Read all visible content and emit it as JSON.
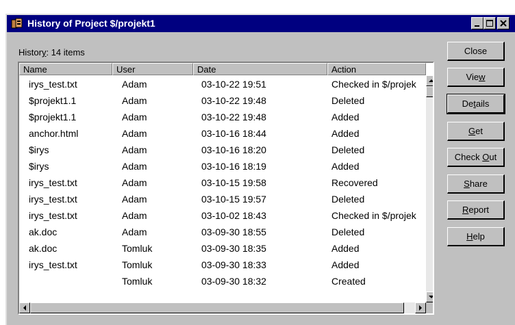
{
  "window": {
    "title": "History of Project $/projekt1"
  },
  "history_label": {
    "prefix": "Histor",
    "underlined": "y",
    "suffix": ": 14 items"
  },
  "columns": [
    "Name",
    "User",
    "Date",
    "Action"
  ],
  "rows": [
    {
      "name": "irys_test.txt",
      "user": "Adam",
      "date": "03-10-22 19:51",
      "action": "Checked in $/projek"
    },
    {
      "name": "$projekt1.1",
      "user": "Adam",
      "date": "03-10-22 19:48",
      "action": "Deleted"
    },
    {
      "name": "$projekt1.1",
      "user": "Adam",
      "date": "03-10-22 19:48",
      "action": "Added"
    },
    {
      "name": "anchor.html",
      "user": "Adam",
      "date": "03-10-16 18:44",
      "action": "Added"
    },
    {
      "name": "$irys",
      "user": "Adam",
      "date": "03-10-16 18:20",
      "action": "Deleted"
    },
    {
      "name": "$irys",
      "user": "Adam",
      "date": "03-10-16 18:19",
      "action": "Added"
    },
    {
      "name": "irys_test.txt",
      "user": "Adam",
      "date": "03-10-15 19:58",
      "action": "Recovered"
    },
    {
      "name": "irys_test.txt",
      "user": "Adam",
      "date": "03-10-15 19:57",
      "action": "Deleted"
    },
    {
      "name": "irys_test.txt",
      "user": "Adam",
      "date": "03-10-02 18:43",
      "action": "Checked in $/projek"
    },
    {
      "name": "ak.doc",
      "user": "Adam",
      "date": "03-09-30 18:55",
      "action": "Deleted"
    },
    {
      "name": "ak.doc",
      "user": "Tomluk",
      "date": "03-09-30 18:35",
      "action": "Added"
    },
    {
      "name": "irys_test.txt",
      "user": "Tomluk",
      "date": "03-09-30 18:33",
      "action": "Added"
    },
    {
      "name": "",
      "user": "Tomluk",
      "date": "03-09-30 18:32",
      "action": "Created"
    }
  ],
  "buttons": [
    {
      "id": "close",
      "pre": "Close",
      "u": "",
      "post": ""
    },
    {
      "id": "view",
      "pre": "Vie",
      "u": "w",
      "post": ""
    },
    {
      "id": "details",
      "pre": "De",
      "u": "t",
      "post": "ails"
    },
    {
      "id": "get",
      "pre": "",
      "u": "G",
      "post": "et"
    },
    {
      "id": "check-out",
      "pre": "Check ",
      "u": "O",
      "post": "ut"
    },
    {
      "id": "share",
      "pre": "",
      "u": "S",
      "post": "hare"
    },
    {
      "id": "report",
      "pre": "",
      "u": "R",
      "post": "eport"
    },
    {
      "id": "help",
      "pre": "",
      "u": "H",
      "post": "elp"
    }
  ],
  "colors": {
    "title_bar": "#000080",
    "face": "#c0c0c0"
  },
  "icons": [
    "app-icon",
    "minimize-icon",
    "maximize-icon",
    "close-icon",
    "scroll-up-icon",
    "scroll-down-icon",
    "scroll-left-icon",
    "scroll-right-icon"
  ]
}
